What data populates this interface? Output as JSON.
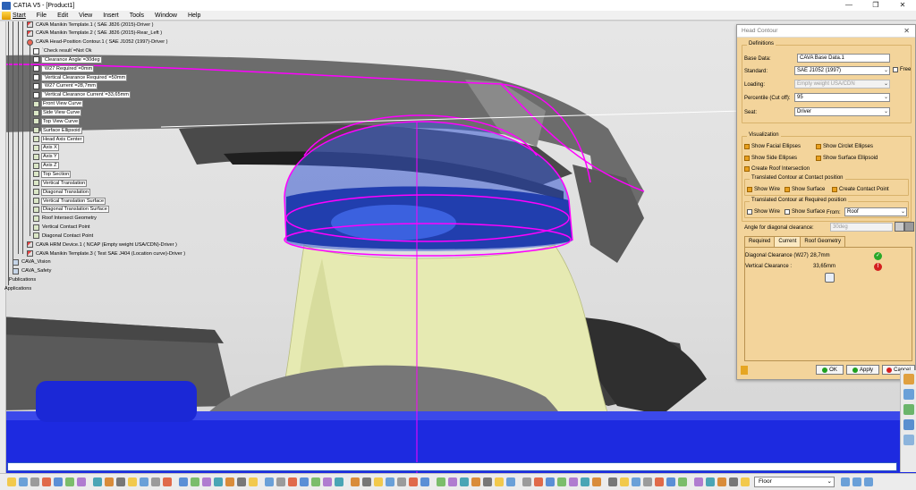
{
  "window": {
    "title": "CATIA V5 - [Product1]",
    "controls": [
      "—",
      "❐",
      "✕"
    ]
  },
  "menu": [
    "Start",
    "File",
    "Edit",
    "View",
    "Insert",
    "Tools",
    "Window",
    "Help"
  ],
  "tree": [
    {
      "label": "CAVA Manikin Template.1 ( SAE J826 (2015)-Driver )",
      "icon": "tpl",
      "indent": 30,
      "boxed": false
    },
    {
      "label": "CAVA Manikin Template.2 ( SAE J826 (2015)-Rear_Left )",
      "icon": "tpl",
      "indent": 30,
      "boxed": false
    },
    {
      "label": "CAVA Head-Position Contour.1 ( SAE J1052 (1997)-Driver )",
      "icon": "head",
      "indent": 30,
      "boxed": false
    },
    {
      "label": "`Check result`=Not Ok",
      "icon": "param",
      "indent": 37,
      "boxed": false
    },
    {
      "label": "`Clearance Angle`=30deg",
      "icon": "param",
      "indent": 37,
      "boxed": true
    },
    {
      "label": "`W27 Required`=0mm",
      "icon": "param",
      "indent": 37,
      "boxed": true
    },
    {
      "label": "`Vertical Clearance Required`=50mm",
      "icon": "param",
      "indent": 37,
      "boxed": true
    },
    {
      "label": "`W27 Current`=28,7mm",
      "icon": "param",
      "indent": 37,
      "boxed": true
    },
    {
      "label": "`Vertical Clearance Current`=33,65mm",
      "icon": "param",
      "indent": 37,
      "boxed": true
    },
    {
      "label": "Front View Curve",
      "icon": "geo",
      "indent": 37,
      "boxed": true
    },
    {
      "label": "Side View Curve",
      "icon": "geo",
      "indent": 37,
      "boxed": true
    },
    {
      "label": "Top View Curve",
      "icon": "geo",
      "indent": 37,
      "boxed": true
    },
    {
      "label": "Surface Ellipsoid",
      "icon": "geo",
      "indent": 37,
      "boxed": true
    },
    {
      "label": "Head Axis Center",
      "icon": "geo",
      "indent": 37,
      "boxed": true
    },
    {
      "label": "Axis X",
      "icon": "geo",
      "indent": 37,
      "boxed": true
    },
    {
      "label": "Axis Y",
      "icon": "geo",
      "indent": 37,
      "boxed": true
    },
    {
      "label": "Axis Z",
      "icon": "geo",
      "indent": 37,
      "boxed": true
    },
    {
      "label": "Top Section",
      "icon": "geo",
      "indent": 37,
      "boxed": true
    },
    {
      "label": "Vertical Translation",
      "icon": "geo",
      "indent": 37,
      "boxed": true
    },
    {
      "label": "Diagonal Translation",
      "icon": "geo",
      "indent": 37,
      "boxed": true
    },
    {
      "label": "Vertical Translation Surface",
      "icon": "geo",
      "indent": 37,
      "boxed": true
    },
    {
      "label": "Diagonal Translation Surface",
      "icon": "geo",
      "indent": 37,
      "boxed": true
    },
    {
      "label": "Roof Intersect Geometry",
      "icon": "geo",
      "indent": 37,
      "boxed": false
    },
    {
      "label": "Vertical Contact Point",
      "icon": "geo",
      "indent": 37,
      "boxed": false
    },
    {
      "label": "Diagonal Contact Point",
      "icon": "geo",
      "indent": 37,
      "boxed": false
    },
    {
      "label": "CAVA HRM Device.1 ( NCAP (Empty weight USA/CDN)-Driver )",
      "icon": "tpl",
      "indent": 30,
      "boxed": false
    },
    {
      "label": "CAVA Manikin Template.3 ( Test SAE J404 (Location curve)-Driver )",
      "icon": "tpl",
      "indent": 30,
      "boxed": false
    },
    {
      "label": "CAVA_Vision",
      "icon": "prod",
      "indent": 14,
      "boxed": false
    },
    {
      "label": "CAVA_Safety",
      "icon": "prod",
      "indent": 14,
      "boxed": false
    },
    {
      "label": "Publications",
      "icon": "none",
      "indent": 9,
      "boxed": false
    },
    {
      "label": "Applications",
      "icon": "none",
      "indent": 4,
      "boxed": false
    }
  ],
  "dialog": {
    "title": "Head Contour",
    "close": "✕",
    "definitions_label": "Definitions",
    "base_data_label": "Base Data:",
    "base_data_value": "CAVA Base Data.1",
    "standard_label": "Standard:",
    "standard_value": "SAE J1052 (1997)",
    "free_label": "Free",
    "loading_label": "Loading:",
    "loading_value": "Empty weight USA/CDN",
    "percentile_label": "Percentile (Cut off):",
    "percentile_value": "95",
    "seat_label": "Seat:",
    "seat_value": "Driver",
    "visualization_label": "Visualization",
    "show_facial_ellipses": "Show Facial Ellipses",
    "show_circlet_ellipses": "Show Circlet Ellipses",
    "show_side_ellipses": "Show Side Ellipses",
    "show_surface_ellipsoid": "Show Surface Ellipsoid",
    "create_roof_intersection": "Create Roof Intersection",
    "contact_frame_label": "Translated Contour at Contact position",
    "contact_show_wire": "Show Wire",
    "contact_show_surface": "Show Surface",
    "create_contact_point": "Create Contact Point",
    "required_frame_label": "Translated Contour at Required position",
    "req_show_wire": "Show Wire",
    "req_show_surface": "Show Surface",
    "from_label": "From:",
    "from_value": "Roof",
    "angle_label": "Angle for diagonal clearance:",
    "angle_value": "30deg",
    "tabs": [
      "Required",
      "Current",
      "Roof Geometry"
    ],
    "diag_label": "Diagonal Clearance (W27) :",
    "diag_value": "28,7mm",
    "vert_label": "Vertical Clearance :",
    "vert_value": "33,65mm",
    "ok_label": "OK",
    "apply_label": "Apply",
    "cancel_label": "Cancel"
  },
  "floor_select": "Floor",
  "colors": {
    "accent": "#ff00ff",
    "ellipsoid": "#1e3fb0",
    "neck": "#e9edb8",
    "dialog_bg": "#f3d49b"
  }
}
